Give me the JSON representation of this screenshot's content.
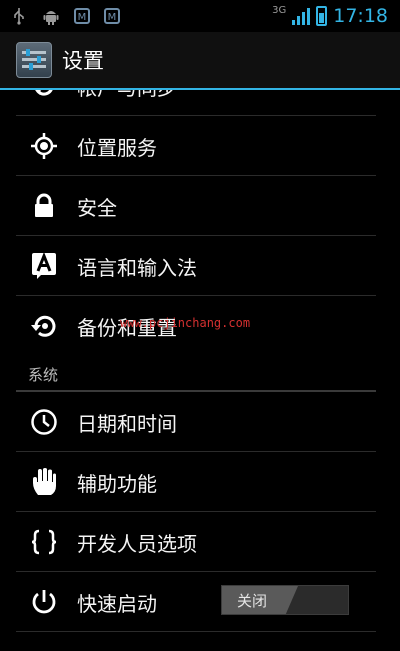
{
  "status_bar": {
    "network_type": "3G",
    "time": "17:18",
    "icons": [
      "usb-icon",
      "android-debug-icon",
      "notification-m-icon",
      "notification-m-icon-2",
      "signal-icon",
      "battery-charging-icon"
    ]
  },
  "action_bar": {
    "title": "设置",
    "icon": "settings-app-icon",
    "accent_color": "#33b5e5"
  },
  "list": {
    "partial_item": {
      "label": "帐户与同步",
      "icon": "sync-icon"
    },
    "items": [
      {
        "label": "位置服务",
        "icon": "location-icon"
      },
      {
        "label": "安全",
        "icon": "lock-icon"
      },
      {
        "label": "语言和输入法",
        "icon": "language-icon"
      },
      {
        "label": "备份和重置",
        "icon": "backup-reset-icon"
      }
    ],
    "section_header": "系统",
    "system_items": [
      {
        "label": "日期和时间",
        "icon": "clock-icon"
      },
      {
        "label": "辅助功能",
        "icon": "hand-icon"
      },
      {
        "label": "开发人员选项",
        "icon": "braces-icon"
      },
      {
        "label": "快速启动",
        "icon": "power-icon",
        "toggle": {
          "state_label": "关闭",
          "on": false
        }
      }
    ]
  },
  "watermark": "www.pcjinchang.com"
}
